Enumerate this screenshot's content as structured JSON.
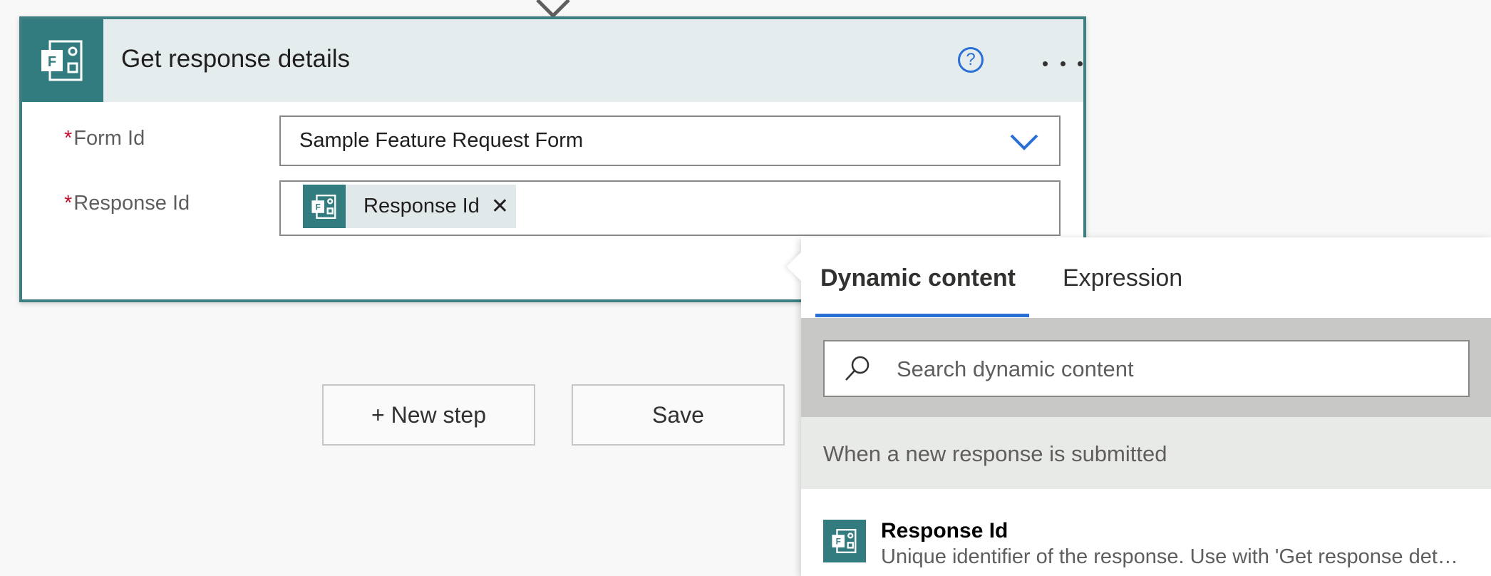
{
  "card": {
    "title": "Get response details",
    "app_icon": "forms-icon",
    "help_label": "?",
    "fields": [
      {
        "required_marker": "*",
        "label": "Form Id",
        "value": "Sample Feature Request Form"
      },
      {
        "required_marker": "*",
        "label": "Response Id",
        "token_label": "Response Id",
        "token_close": "✕"
      }
    ]
  },
  "buttons": {
    "new_step": "+ New step",
    "save": "Save"
  },
  "panel": {
    "tabs": [
      {
        "label": "Dynamic content",
        "active": true
      },
      {
        "label": "Expression",
        "active": false
      }
    ],
    "search": {
      "placeholder": "Search dynamic content",
      "value": ""
    },
    "section_title": "When a new response is submitted",
    "items": [
      {
        "title": "Response Id",
        "description": "Unique identifier of the response. Use with 'Get response details' action."
      }
    ]
  },
  "colors": {
    "accent": "#2a6fd6",
    "card_border": "#3e8082",
    "icon_bg": "#327c7f",
    "required": "#c8102e"
  }
}
